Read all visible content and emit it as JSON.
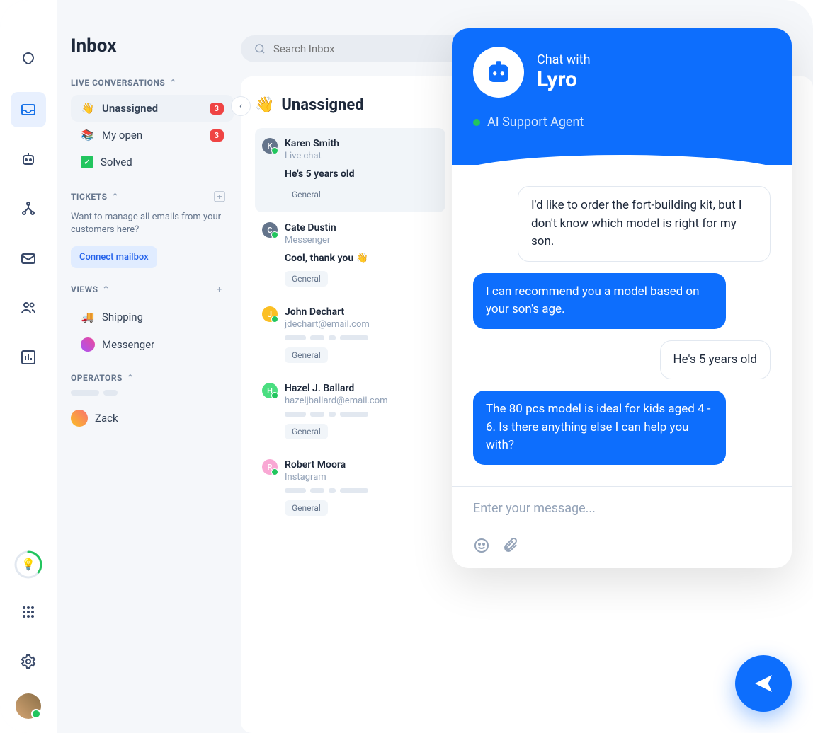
{
  "page_title": "Inbox",
  "search": {
    "placeholder": "Search Inbox"
  },
  "sections": {
    "live": {
      "title": "LIVE CONVERSATIONS"
    },
    "tickets": {
      "title": "TICKETS",
      "help": "Want to manage all emails from your customers here?",
      "connect": "Connect mailbox"
    },
    "views": {
      "title": "VIEWS"
    },
    "operators": {
      "title": "OPERATORS"
    }
  },
  "nav": {
    "unassigned": {
      "label": "Unassigned",
      "badge": "3",
      "emoji": "👋"
    },
    "myopen": {
      "label": "My open",
      "badge": "3",
      "emoji": "📚"
    },
    "solved": {
      "label": "Solved"
    },
    "shipping": {
      "label": "Shipping",
      "emoji": "🚚"
    },
    "messenger": {
      "label": "Messenger",
      "emoji": "💬"
    }
  },
  "operators": {
    "zack": {
      "name": "Zack"
    }
  },
  "list": {
    "title": "Unassigned",
    "emoji": "👋",
    "items": [
      {
        "initial": "K",
        "color": "#64748b",
        "name": "Karen Smith",
        "channel": "Live chat",
        "preview": "He's 5 years old",
        "tag": "General"
      },
      {
        "initial": "C",
        "color": "#64748b",
        "name": "Cate Dustin",
        "channel": "Messenger",
        "preview": "Cool, thank you 👋",
        "tag": "General"
      },
      {
        "initial": "J",
        "color": "#fbbf24",
        "name": "John Dechart",
        "channel": "jdechart@email.com",
        "preview": "",
        "tag": "General"
      },
      {
        "initial": "H",
        "color": "#4ade80",
        "name": "Hazel J. Ballard",
        "channel": "hazeljballard@email.com",
        "preview": "",
        "tag": "General"
      },
      {
        "initial": "R",
        "color": "#f9a8d4",
        "name": "Robert Moora",
        "channel": "Instagram",
        "preview": "",
        "tag": "General"
      }
    ]
  },
  "chat": {
    "title_small": "Chat with",
    "title_big": "Lyro",
    "status": "AI Support Agent",
    "messages": [
      {
        "role": "user",
        "text": "I'd like to order the fort-building kit, but I don't know which model is right for my son."
      },
      {
        "role": "bot",
        "text": "I can recommend you a model based on your son's age."
      },
      {
        "role": "user",
        "text": "He's 5 years old"
      },
      {
        "role": "bot",
        "text": "The 80 pcs model is ideal for kids aged 4 - 6. Is there anything else I can help you with?"
      }
    ],
    "input_placeholder": "Enter your message..."
  }
}
